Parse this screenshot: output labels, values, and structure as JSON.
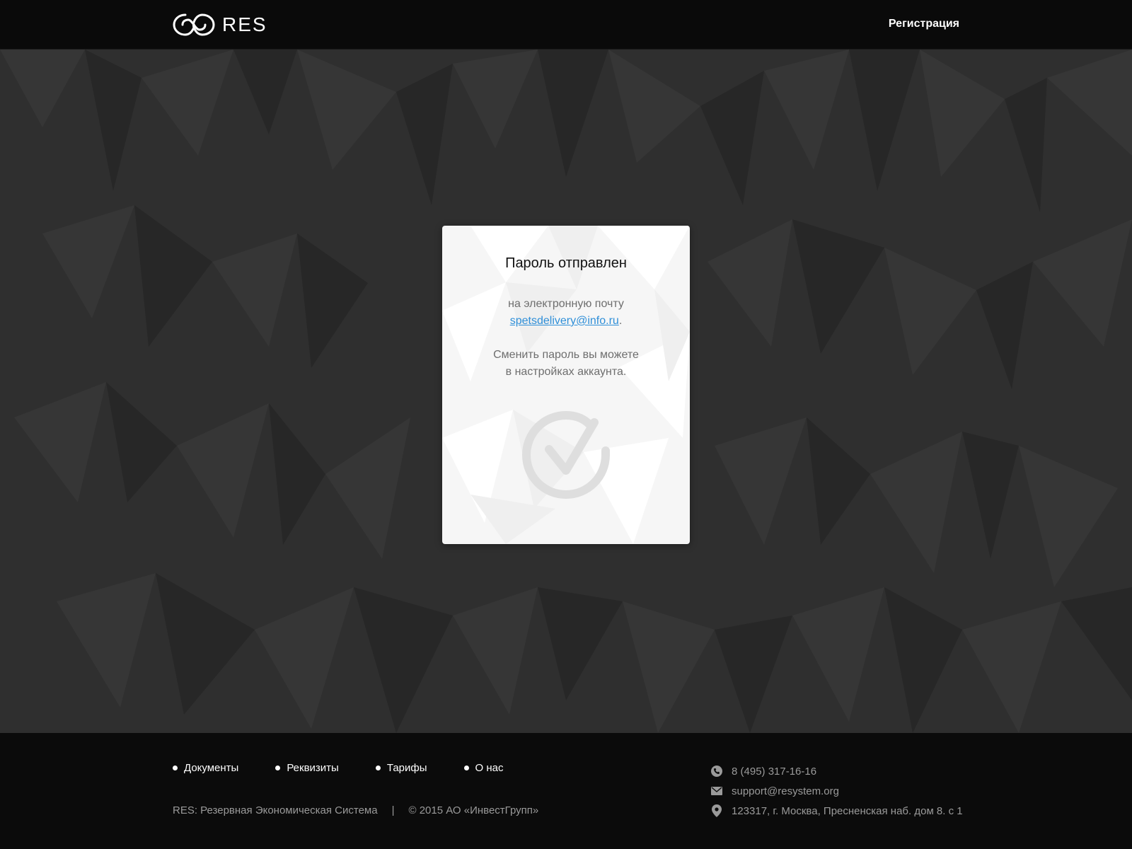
{
  "header": {
    "logo_text": "RES",
    "register_label": "Регистрация"
  },
  "card": {
    "title": "Пароль отправлен",
    "line1": "на электронную почту",
    "email": "spetsdelivery@info.ru",
    "email_suffix": ".",
    "line2": "Сменить пароль вы можете",
    "line3": "в настройках аккаунта.",
    "icon": "check-circle-icon"
  },
  "footer": {
    "nav": [
      {
        "label": "Документы"
      },
      {
        "label": "Реквизиты"
      },
      {
        "label": "Тарифы"
      },
      {
        "label": "О нас"
      }
    ],
    "tagline": "RES: Резервная Экономическая Система",
    "separator": "|",
    "copyright": "© 2015 АО «ИнвестГрупп»",
    "contacts": {
      "phone": "8 (495) 317-16-16",
      "email": "support@resystem.org",
      "address": "123317, г. Москва, Пресненская наб. дом 8. с 1"
    }
  },
  "colors": {
    "header_bg": "#0a0a0a",
    "page_bg": "#2f2f2f",
    "card_bg": "#f6f6f6",
    "link": "#2f8fd8",
    "muted": "#9a9a9a"
  }
}
